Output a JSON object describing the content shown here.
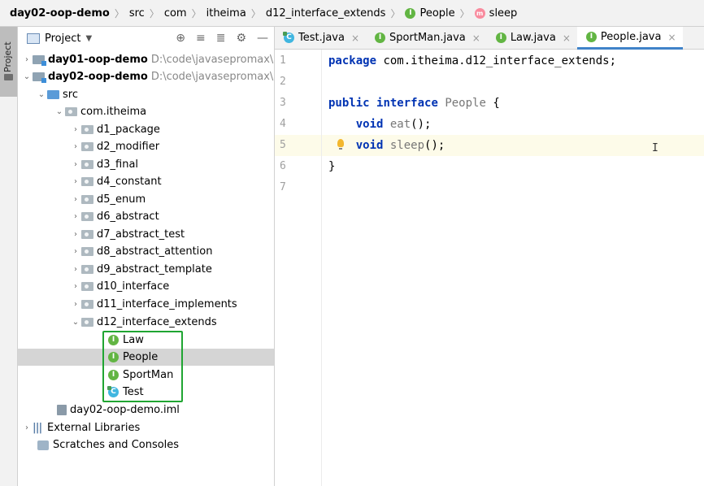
{
  "breadcrumb": {
    "items": [
      "day02-oop-demo",
      "src",
      "com",
      "itheima",
      "d12_interface_extends",
      "People",
      "sleep"
    ]
  },
  "sidebar_strip": {
    "label": "Project"
  },
  "project_panel": {
    "title": "Project",
    "tree": [
      {
        "label": "day01-oop-demo",
        "path": "D:\\code\\javasepromax\\"
      },
      {
        "label": "day02-oop-demo",
        "path": "D:\\code\\javasepromax\\"
      },
      {
        "label": "src"
      },
      {
        "label": "com.itheima"
      },
      {
        "label": "d1_package"
      },
      {
        "label": "d2_modifier"
      },
      {
        "label": "d3_final"
      },
      {
        "label": "d4_constant"
      },
      {
        "label": "d5_enum"
      },
      {
        "label": "d6_abstract"
      },
      {
        "label": "d7_abstract_test"
      },
      {
        "label": "d8_abstract_attention"
      },
      {
        "label": "d9_abstract_template"
      },
      {
        "label": "d10_interface"
      },
      {
        "label": "d11_interface_implements"
      },
      {
        "label": "d12_interface_extends"
      },
      {
        "label": "Law"
      },
      {
        "label": "People"
      },
      {
        "label": "SportMan"
      },
      {
        "label": "Test"
      },
      {
        "label": "day02-oop-demo.iml"
      },
      {
        "label": "External Libraries"
      },
      {
        "label": "Scratches and Consoles"
      }
    ]
  },
  "editor_tabs": [
    {
      "label": "Test.java"
    },
    {
      "label": "SportMan.java"
    },
    {
      "label": "Law.java"
    },
    {
      "label": "People.java"
    }
  ],
  "editor": {
    "line_numbers": [
      "1",
      "2",
      "3",
      "4",
      "5",
      "6",
      "7"
    ],
    "code": {
      "l1_kw": "package",
      "l1_rest": " com.itheima.d12_interface_extends;",
      "l3_kw1": "public",
      "l3_kw2": "interface",
      "l3_name": "People",
      "l3_rest": " {",
      "l4_kw": "void",
      "l4_name": "eat",
      "l4_rest": "();",
      "l5_kw": "void",
      "l5_name": "sleep",
      "l5_rest": "();",
      "l6": "}"
    },
    "cursor": "I"
  },
  "colors": {
    "interface_icon": "#62b543",
    "method_icon": "#f98b9e",
    "class_icon": "#40b6e0",
    "keyword": "#0033b3",
    "highlight_box": "#20a532",
    "active_tab_underline": "#4083c9"
  }
}
